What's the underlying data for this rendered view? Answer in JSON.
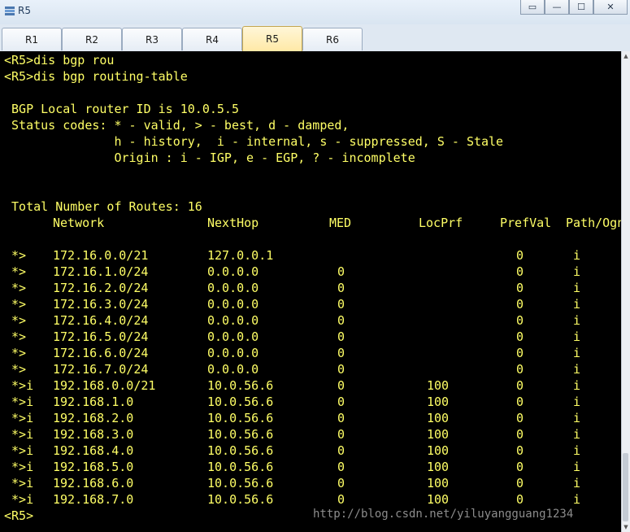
{
  "window": {
    "title": "R5",
    "min_glyph": "—",
    "max_glyph": "☐",
    "close_glyph": "✕"
  },
  "tabs": [
    "R1",
    "R2",
    "R3",
    "R4",
    "R5",
    "R6"
  ],
  "active_tab": "R5",
  "terminal": {
    "lines": [
      "<R5>dis bgp rou",
      "<R5>dis bgp routing-table",
      "",
      " BGP Local router ID is 10.0.5.5",
      " Status codes: * - valid, > - best, d - damped,",
      "               h - history,  i - internal, s - suppressed, S - Stale",
      "               Origin : i - IGP, e - EGP, ? - incomplete",
      "",
      "",
      " Total Number of Routes: 16"
    ],
    "headers": {
      "network": "Network",
      "nexthop": "NextHop",
      "med": "MED",
      "locprf": "LocPrf",
      "prefval": "PrefVal",
      "path": "Path/Ogn"
    },
    "routes": [
      {
        "status": " *>",
        "network": "172.16.0.0/21",
        "nexthop": "127.0.0.1",
        "med": "",
        "locprf": "",
        "prefval": "0",
        "path": "i"
      },
      {
        "status": " *>",
        "network": "172.16.1.0/24",
        "nexthop": "0.0.0.0",
        "med": "0",
        "locprf": "",
        "prefval": "0",
        "path": "i"
      },
      {
        "status": " *>",
        "network": "172.16.2.0/24",
        "nexthop": "0.0.0.0",
        "med": "0",
        "locprf": "",
        "prefval": "0",
        "path": "i"
      },
      {
        "status": " *>",
        "network": "172.16.3.0/24",
        "nexthop": "0.0.0.0",
        "med": "0",
        "locprf": "",
        "prefval": "0",
        "path": "i"
      },
      {
        "status": " *>",
        "network": "172.16.4.0/24",
        "nexthop": "0.0.0.0",
        "med": "0",
        "locprf": "",
        "prefval": "0",
        "path": "i"
      },
      {
        "status": " *>",
        "network": "172.16.5.0/24",
        "nexthop": "0.0.0.0",
        "med": "0",
        "locprf": "",
        "prefval": "0",
        "path": "i"
      },
      {
        "status": " *>",
        "network": "172.16.6.0/24",
        "nexthop": "0.0.0.0",
        "med": "0",
        "locprf": "",
        "prefval": "0",
        "path": "i"
      },
      {
        "status": " *>",
        "network": "172.16.7.0/24",
        "nexthop": "0.0.0.0",
        "med": "0",
        "locprf": "",
        "prefval": "0",
        "path": "i"
      },
      {
        "status": " *>i",
        "network": "192.168.0.0/21",
        "nexthop": "10.0.56.6",
        "med": "0",
        "locprf": "100",
        "prefval": "0",
        "path": "i"
      },
      {
        "status": " *>i",
        "network": "192.168.1.0",
        "nexthop": "10.0.56.6",
        "med": "0",
        "locprf": "100",
        "prefval": "0",
        "path": "i"
      },
      {
        "status": " *>i",
        "network": "192.168.2.0",
        "nexthop": "10.0.56.6",
        "med": "0",
        "locprf": "100",
        "prefval": "0",
        "path": "i"
      },
      {
        "status": " *>i",
        "network": "192.168.3.0",
        "nexthop": "10.0.56.6",
        "med": "0",
        "locprf": "100",
        "prefval": "0",
        "path": "i"
      },
      {
        "status": " *>i",
        "network": "192.168.4.0",
        "nexthop": "10.0.56.6",
        "med": "0",
        "locprf": "100",
        "prefval": "0",
        "path": "i"
      },
      {
        "status": " *>i",
        "network": "192.168.5.0",
        "nexthop": "10.0.56.6",
        "med": "0",
        "locprf": "100",
        "prefval": "0",
        "path": "i"
      },
      {
        "status": " *>i",
        "network": "192.168.6.0",
        "nexthop": "10.0.56.6",
        "med": "0",
        "locprf": "100",
        "prefval": "0",
        "path": "i"
      },
      {
        "status": " *>i",
        "network": "192.168.7.0",
        "nexthop": "10.0.56.6",
        "med": "0",
        "locprf": "100",
        "prefval": "0",
        "path": "i"
      }
    ],
    "prompt": "<R5>"
  },
  "watermark": "http://blog.csdn.net/yiluyangguang1234",
  "colors": {
    "terminal_bg": "#000000",
    "terminal_fg": "#ffff66",
    "active_tab": "#ffe9a6"
  }
}
